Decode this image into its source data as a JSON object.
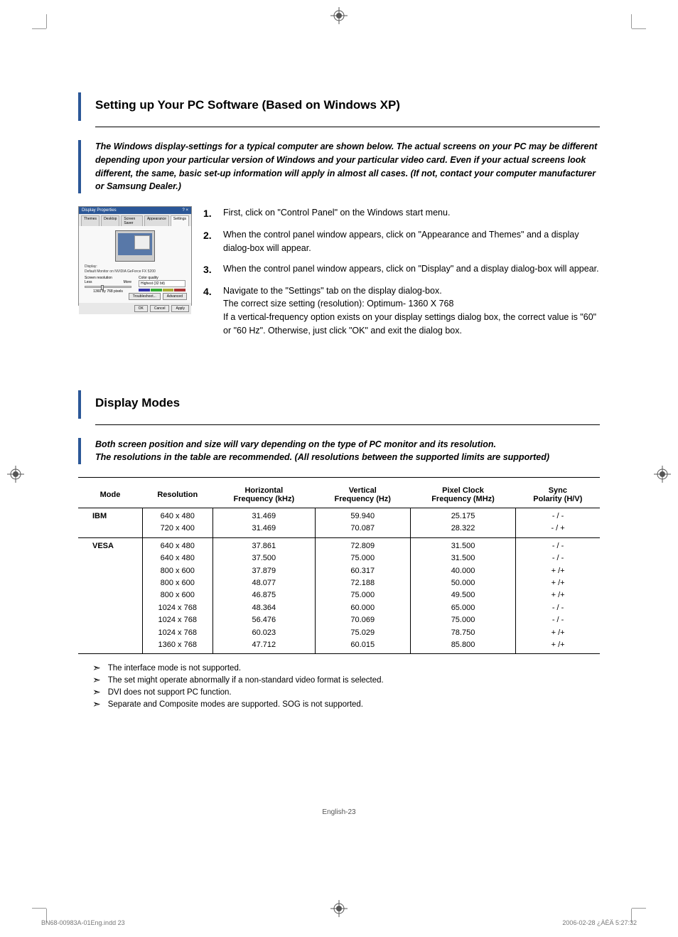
{
  "section1": {
    "title": "Setting up Your PC Software (Based on Windows XP)",
    "intro": "The Windows display-settings for a typical computer are shown below. The actual screens on your PC may be different depending upon your particular version of Windows and your particular video card. Even if your actual screens look different, the same, basic set-up information will apply in almost all cases. (If not, contact your computer manufacturer or Samsung Dealer.)",
    "dialog": {
      "title": "Display Properties",
      "tabs": [
        "Themes",
        "Desktop",
        "Screen Saver",
        "Appearance",
        "Settings"
      ],
      "display_label": "Display:",
      "display_text": "Default Monitor on NVIDIA GeForce FX 5200",
      "res_label": "Screen resolution",
      "less": "Less",
      "more": "More",
      "res_text": "1360 by 768 pixels",
      "cq_label": "Color quality",
      "cq_value": "Highest (32 bit)",
      "troubleshoot": "Troubleshoot...",
      "advanced": "Advanced",
      "ok": "OK",
      "cancel": "Cancel",
      "apply": "Apply"
    },
    "steps": [
      {
        "num": "1.",
        "text": "First, click on \"Control Panel\" on the Windows start menu."
      },
      {
        "num": "2.",
        "text": "When the control panel window appears, click on \"Appearance and Themes\" and a display dialog-box will appear."
      },
      {
        "num": "3.",
        "text": "When the control panel window appears, click on \"Display\" and a display dialog-box will appear."
      },
      {
        "num": "4.",
        "text": "Navigate to the \"Settings\" tab on the display dialog-box.\nThe correct size setting (resolution): Optimum- 1360 X 768\nIf a vertical-frequency option exists on your display settings dialog box, the correct value is \"60\" or \"60 Hz\". Otherwise, just click \"OK\" and exit the dialog box."
      }
    ]
  },
  "section2": {
    "title": "Display Modes",
    "intro": "Both screen position and size will vary depending on the type of PC monitor and its resolution.\nThe resolutions in the table are recommended. (All resolutions between the supported limits are supported)",
    "headers": [
      "Mode",
      "Resolution",
      "Horizontal Frequency (kHz)",
      "Vertical Frequency (Hz)",
      "Pixel Clock Frequency (MHz)",
      "Sync Polarity (H/V)"
    ],
    "groups": [
      {
        "mode": "IBM",
        "rows": [
          {
            "res": "640 x 480",
            "h": "31.469",
            "v": "59.940",
            "p": "25.175",
            "s": "- / -"
          },
          {
            "res": "720 x 400",
            "h": "31.469",
            "v": "70.087",
            "p": "28.322",
            "s": "- / +"
          }
        ]
      },
      {
        "mode": "VESA",
        "rows": [
          {
            "res": "640 x 480",
            "h": "37.861",
            "v": "72.809",
            "p": "31.500",
            "s": "- / -"
          },
          {
            "res": "640 x 480",
            "h": "37.500",
            "v": "75.000",
            "p": "31.500",
            "s": "- / -"
          },
          {
            "res": "800 x 600",
            "h": "37.879",
            "v": "60.317",
            "p": "40.000",
            "s": "+ /+"
          },
          {
            "res": "800 x 600",
            "h": "48.077",
            "v": "72.188",
            "p": "50.000",
            "s": "+ /+"
          },
          {
            "res": "800 x 600",
            "h": "46.875",
            "v": "75.000",
            "p": "49.500",
            "s": "+ /+"
          },
          {
            "res": "1024 x 768",
            "h": "48.364",
            "v": "60.000",
            "p": "65.000",
            "s": "- / -"
          },
          {
            "res": "1024 x 768",
            "h": "56.476",
            "v": "70.069",
            "p": "75.000",
            "s": "- / -"
          },
          {
            "res": "1024 x 768",
            "h": "60.023",
            "v": "75.029",
            "p": "78.750",
            "s": "+ /+"
          },
          {
            "res": "1360 x 768",
            "h": "47.712",
            "v": "60.015",
            "p": "85.800",
            "s": "+ /+"
          }
        ]
      }
    ],
    "notes": [
      "The interface mode is not supported.",
      "The set might operate abnormally if a non-standard video format is selected.",
      "DVI does not support PC function.",
      "Separate and Composite modes are supported. SOG is not supported."
    ]
  },
  "footer": {
    "page": "English-23",
    "left": "BN68-00983A-01Eng.indd   23",
    "right": "2006-02-28   ¿ÀÈÄ 5:27:32"
  }
}
